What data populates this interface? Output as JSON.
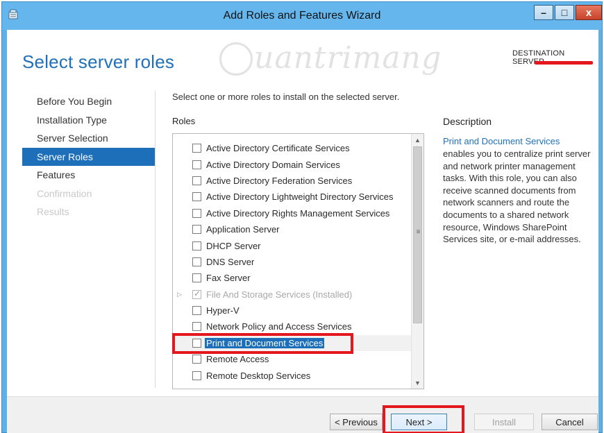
{
  "window": {
    "title": "Add Roles and Features Wizard",
    "controls": {
      "minimize": "–",
      "maximize": "□",
      "close": "x"
    }
  },
  "header": {
    "page_title": "Select server roles",
    "destination_label": "DESTINATION SERVER",
    "watermark": "uantrimang"
  },
  "nav": {
    "items": [
      {
        "label": "Before You Begin",
        "state": "normal"
      },
      {
        "label": "Installation Type",
        "state": "normal"
      },
      {
        "label": "Server Selection",
        "state": "normal"
      },
      {
        "label": "Server Roles",
        "state": "active"
      },
      {
        "label": "Features",
        "state": "normal"
      },
      {
        "label": "Confirmation",
        "state": "disabled"
      },
      {
        "label": "Results",
        "state": "disabled"
      }
    ]
  },
  "main": {
    "intro": "Select one or more roles to install on the selected server.",
    "roles_heading": "Roles",
    "roles": [
      {
        "label": "Active Directory Certificate Services",
        "checked": false
      },
      {
        "label": "Active Directory Domain Services",
        "checked": false
      },
      {
        "label": "Active Directory Federation Services",
        "checked": false
      },
      {
        "label": "Active Directory Lightweight Directory Services",
        "checked": false
      },
      {
        "label": "Active Directory Rights Management Services",
        "checked": false
      },
      {
        "label": "Application Server",
        "checked": false
      },
      {
        "label": "DHCP Server",
        "checked": false
      },
      {
        "label": "DNS Server",
        "checked": false
      },
      {
        "label": "Fax Server",
        "checked": false
      },
      {
        "label": "File And Storage Services (Installed)",
        "checked": true,
        "disabled": true,
        "expandable": true
      },
      {
        "label": "Hyper-V",
        "checked": false
      },
      {
        "label": "Network Policy and Access Services",
        "checked": false
      },
      {
        "label": "Print and Document Services",
        "checked": false,
        "selected": true
      },
      {
        "label": "Remote Access",
        "checked": false
      },
      {
        "label": "Remote Desktop Services",
        "checked": false
      }
    ],
    "scroll_position": 0.0
  },
  "description": {
    "heading": "Description",
    "title": "Print and Document Services",
    "body": "enables you to centralize print server and network printer management tasks. With this role, you can also receive scanned documents from network scanners and route the documents to a shared network resource, Windows SharePoint Services site, or e-mail addresses."
  },
  "footer": {
    "previous_label": "< Previous",
    "next_label": "Next >",
    "install_label": "Install",
    "cancel_label": "Cancel"
  },
  "colors": {
    "accent": "#1c6fb8",
    "titlebar": "#64b6ec",
    "annotation": "#e4171f"
  }
}
